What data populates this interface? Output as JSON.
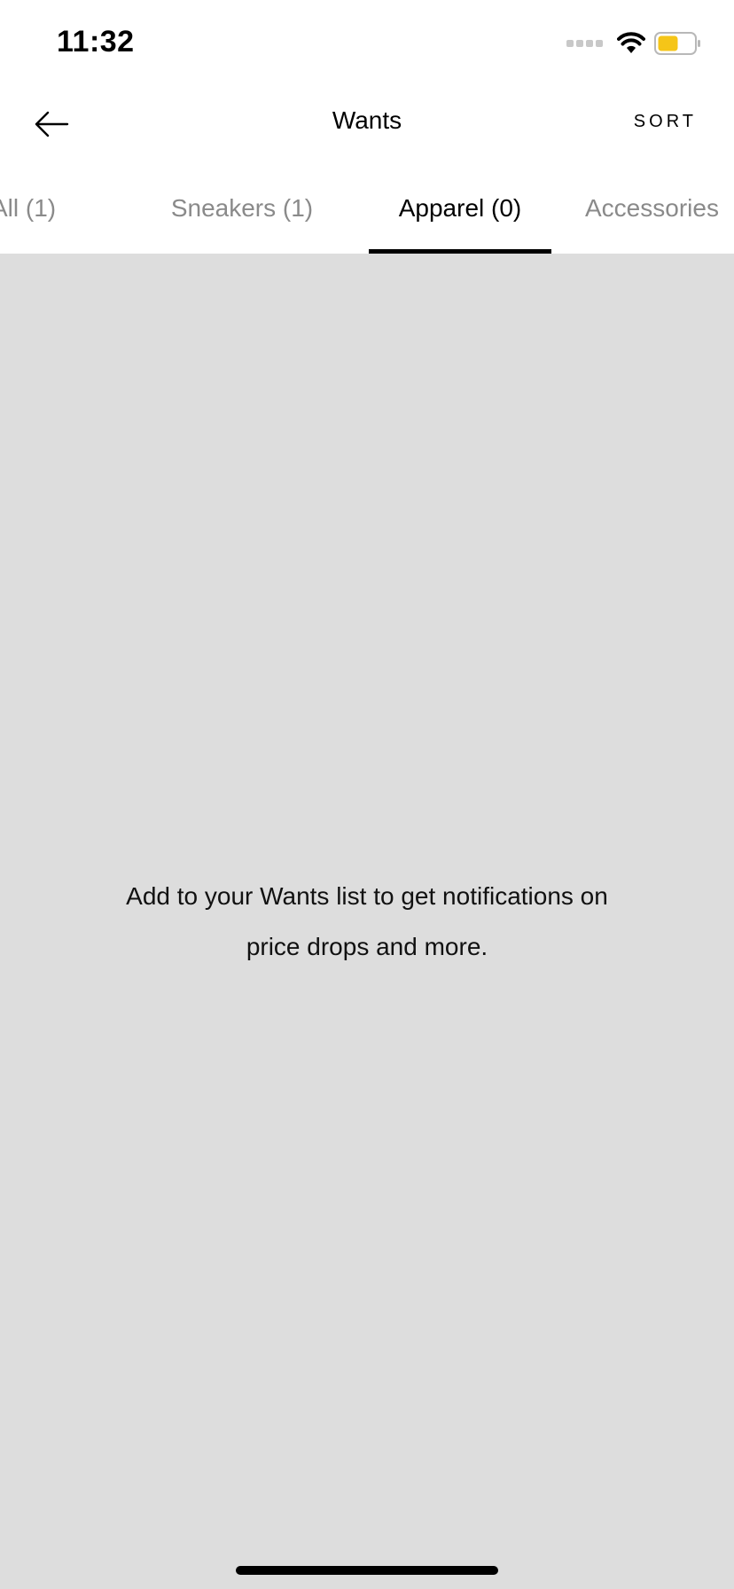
{
  "status_bar": {
    "time": "11:32",
    "icons": [
      "signal-icon",
      "wifi-icon",
      "battery-icon"
    ],
    "battery_color": "#f5c518"
  },
  "nav": {
    "title": "Wants",
    "sort_label": "SORT",
    "back_icon": "arrow-left-icon"
  },
  "tabs": [
    {
      "label": "All (1)",
      "active": false
    },
    {
      "label": "Sneakers (1)",
      "active": false
    },
    {
      "label": "Apparel (0)",
      "active": true
    },
    {
      "label": "Accessories",
      "active": false
    }
  ],
  "empty_state": {
    "message": "Add to your Wants list to get notifications on price drops and more."
  },
  "colors": {
    "background": "#dddddd",
    "inactive_tab": "#8a8a8a",
    "active_tab": "#000000"
  }
}
